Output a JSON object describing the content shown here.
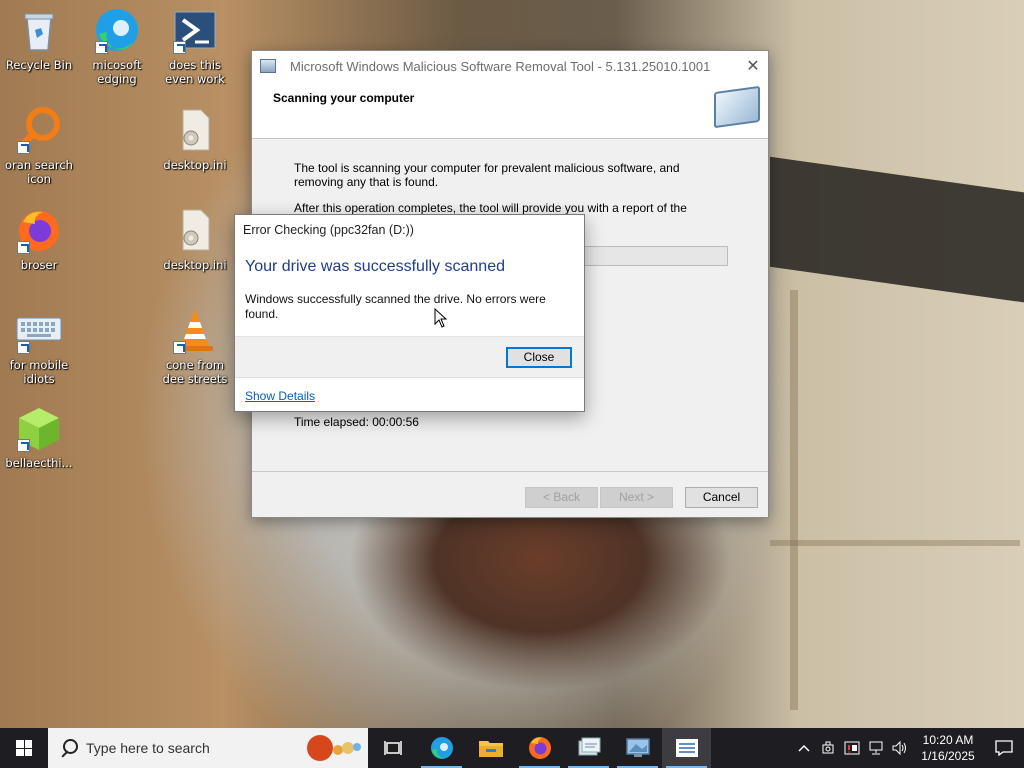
{
  "desktop": {
    "icons": [
      {
        "label": "Recycle Bin"
      },
      {
        "label": "micosoft edging"
      },
      {
        "label": "does this even work"
      },
      {
        "label": "oran search icon"
      },
      {
        "label": "desktop.ini"
      },
      {
        "label": "broser"
      },
      {
        "label": "desktop.ini"
      },
      {
        "label": "for mobile idiots"
      },
      {
        "label": "cone from dee streets"
      },
      {
        "label": "bellaecthi..."
      }
    ]
  },
  "msrt": {
    "title": "Microsoft Windows Malicious Software Removal Tool - 5.131.25010.1001",
    "heading": "Scanning your computer",
    "paragraph1": "The tool is scanning your computer for prevalent malicious software, and removing any that is found.",
    "paragraph2": "After this operation completes, the tool will provide you with a report of the malicious",
    "time_elapsed": "Time elapsed: 00:00:56",
    "back_label": "< Back",
    "next_label": "Next >",
    "cancel_label": "Cancel"
  },
  "error_check": {
    "title": "Error Checking (ppc32fan (D:))",
    "heading": "Your drive was successfully scanned",
    "message": "Windows successfully scanned the drive. No errors were found.",
    "close_label": "Close",
    "details_label": "Show Details"
  },
  "taskbar": {
    "search_placeholder": "Type here to search",
    "pinned": [
      "task-view",
      "edge",
      "file-explorer",
      "firefox",
      "cleanup-tool",
      "msrt",
      "error-checking"
    ],
    "clock_time": "10:20 AM",
    "clock_date": "1/16/2025"
  },
  "colors": {
    "accent": "#0078d7",
    "dialog_heading": "#1e3d8c",
    "link": "#0a5cbd",
    "taskbar": "#1e1e22"
  }
}
